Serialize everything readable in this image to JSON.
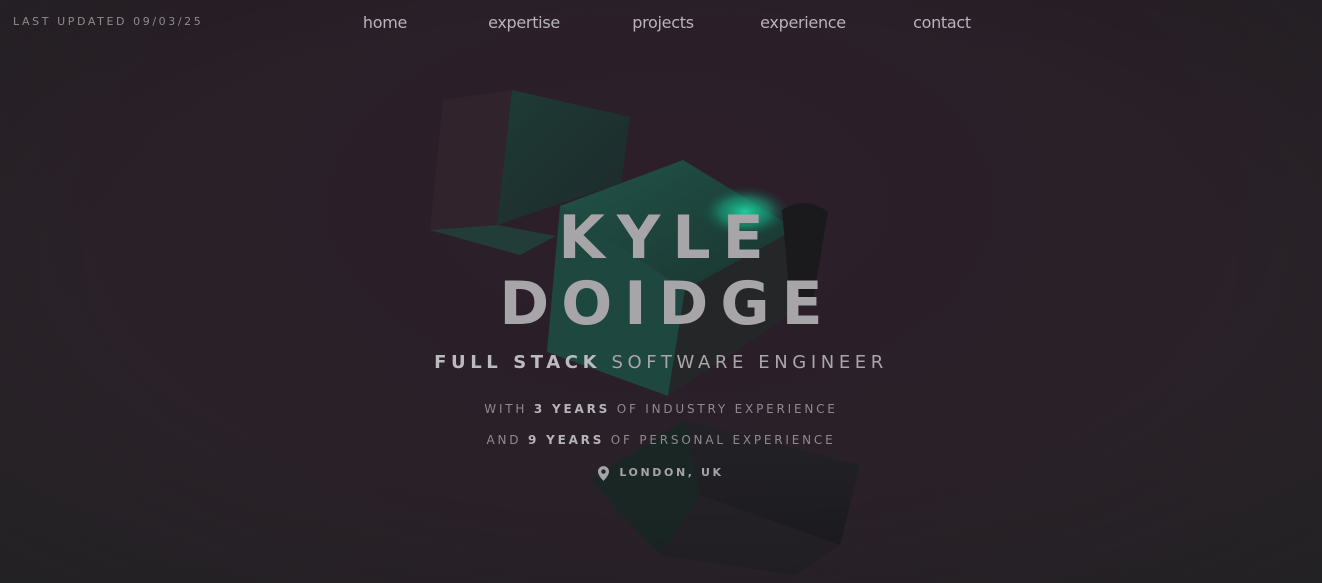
{
  "meta": {
    "last_updated": "LAST UPDATED 09/03/25"
  },
  "nav": {
    "items": [
      {
        "label": "home"
      },
      {
        "label": "expertise"
      },
      {
        "label": "projects"
      },
      {
        "label": "experience"
      },
      {
        "label": "contact"
      }
    ]
  },
  "hero": {
    "first_name": "KYLE",
    "last_name": "DOIDGE",
    "role_bold": "FULL STACK",
    "role_rest": "SOFTWARE ENGINEER",
    "industry": {
      "prefix": "WITH",
      "years": "3 YEARS",
      "suffix": "OF INDUSTRY EXPERIENCE"
    },
    "personal": {
      "prefix": "AND",
      "years": "9 YEARS",
      "suffix": "OF PERSONAL EXPERIENCE"
    },
    "location": "LONDON, UK",
    "location_icon": "map-pin-icon"
  },
  "colors": {
    "background": "#2a1f29",
    "accent": "#1fc89a",
    "text": "#a7a5a8"
  }
}
